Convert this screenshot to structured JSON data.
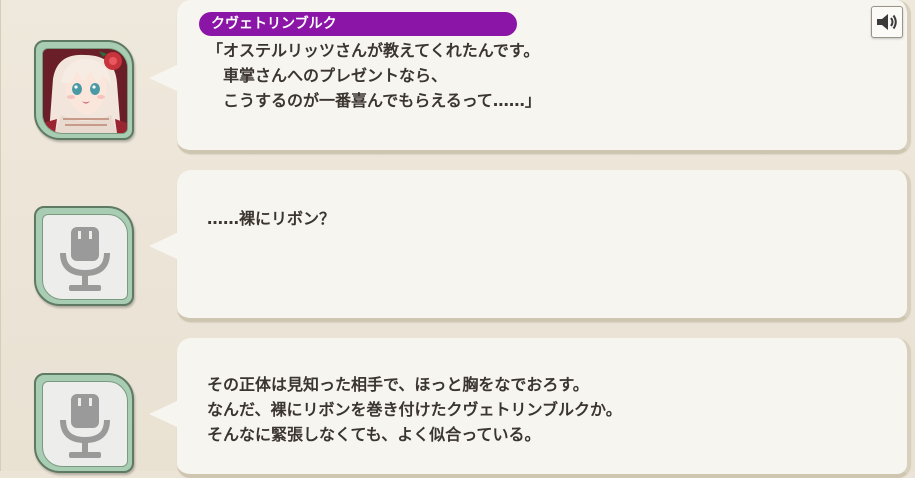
{
  "log_entries": [
    {
      "speaker": "クヴェトリンブルク",
      "text": "「オステルリッツさんが教えてくれたんです。\n　車掌さんへのプレゼントなら、\n　こうするのが一番喜んでもらえるって……」",
      "icon": "character-portrait",
      "has_voice": true,
      "voice_icon": "speaker-icon"
    },
    {
      "speaker": "",
      "text": "……裸にリボン？",
      "icon": "microphone-icon",
      "has_voice": false
    },
    {
      "speaker": "",
      "text": "その正体は見知った相手で、ほっと胸をなでおろす。\nなんだ、裸にリボンを巻き付けたクヴェトリンブルクか。\nそんなに緊張しなくても、よく似合っている。",
      "icon": "microphone-icon",
      "has_voice": false
    }
  ],
  "colors": {
    "name_tag": "#8b15a6",
    "avatar_frame": "#a8cdb3",
    "bubble": "#f7f5f0",
    "background": "#ece4d6",
    "text": "#3b3530"
  }
}
